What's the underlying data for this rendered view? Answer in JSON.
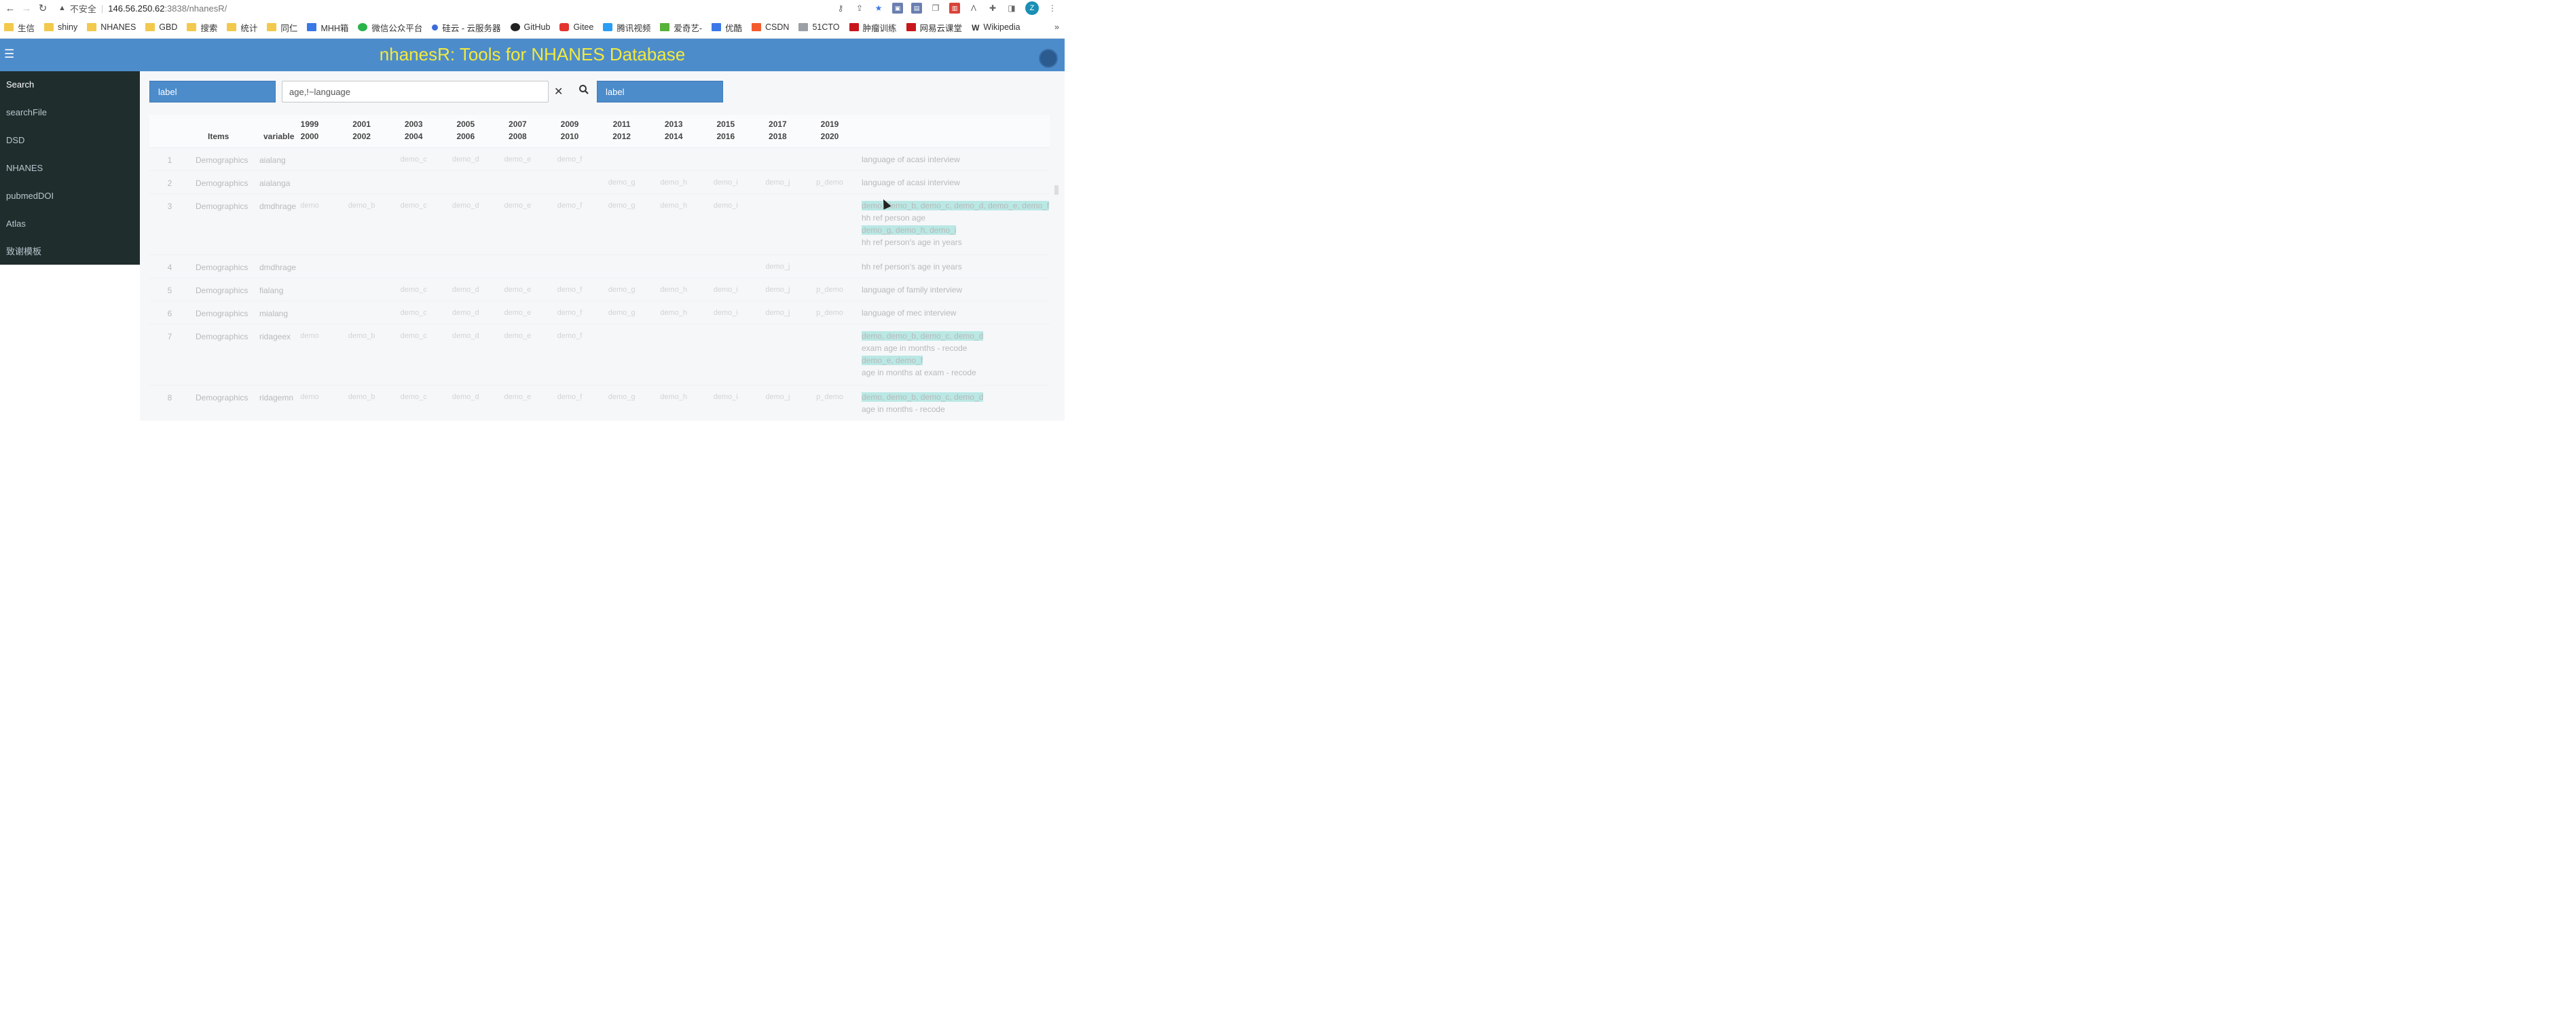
{
  "browser": {
    "insecure_label": "不安全",
    "url_host": "146.56.250.62",
    "url_path": ":3838/nhanesR/",
    "avatar_letter": "Z",
    "bookmarks": [
      {
        "label": "生信",
        "icon": "folder-icon"
      },
      {
        "label": "shiny",
        "icon": "folder-icon"
      },
      {
        "label": "NHANES",
        "icon": "folder-icon"
      },
      {
        "label": "GBD",
        "icon": "folder-icon"
      },
      {
        "label": "搜索",
        "icon": "folder-icon"
      },
      {
        "label": "统计",
        "icon": "folder-icon"
      },
      {
        "label": "同仁",
        "icon": "folder-icon"
      },
      {
        "label": "MHH箱",
        "icon": "outlook-icon"
      },
      {
        "label": "微信公众平台",
        "icon": "wechat-icon"
      },
      {
        "label": "硅云 - 云服务器",
        "icon": "cloud-icon"
      },
      {
        "label": "GitHub",
        "icon": "github-icon"
      },
      {
        "label": "Gitee",
        "icon": "gitee-icon"
      },
      {
        "label": "腾讯视频",
        "icon": "play-icon"
      },
      {
        "label": "爱奇艺-",
        "icon": "iqiyi-icon"
      },
      {
        "label": "优酷",
        "icon": "youku-icon"
      },
      {
        "label": "CSDN",
        "icon": "csdn-icon"
      },
      {
        "label": "51CTO",
        "icon": "51cto-icon"
      },
      {
        "label": "肿瘤训练",
        "icon": "pin-icon"
      },
      {
        "label": "网易云课堂",
        "icon": "netease-icon"
      },
      {
        "label": "Wikipedia",
        "icon": "wikipedia-icon"
      }
    ]
  },
  "app": {
    "title": "nhanesR: Tools for NHANES Database",
    "colors": {
      "header": "#4d8ccb",
      "title": "#f3ea3c",
      "sidebar": "#1f2d2d"
    }
  },
  "sidebar": {
    "items": [
      {
        "label": "Search"
      },
      {
        "label": "searchFile"
      },
      {
        "label": "DSD"
      },
      {
        "label": "NHANES"
      },
      {
        "label": "pubmedDOI"
      },
      {
        "label": "Atlas"
      },
      {
        "label": "致谢模板"
      }
    ]
  },
  "search": {
    "left_select": "label",
    "query": "age,!~language",
    "right_select": "label"
  },
  "table": {
    "headers": {
      "items": "Items",
      "variable": "variable"
    },
    "years": [
      [
        "1999",
        "2000"
      ],
      [
        "2001",
        "2002"
      ],
      [
        "2003",
        "2004"
      ],
      [
        "2005",
        "2006"
      ],
      [
        "2007",
        "2008"
      ],
      [
        "2009",
        "2010"
      ],
      [
        "2011",
        "2012"
      ],
      [
        "2013",
        "2014"
      ],
      [
        "2015",
        "2016"
      ],
      [
        "2017",
        "2018"
      ],
      [
        "2019",
        "2020"
      ]
    ],
    "rows": [
      {
        "n": "1",
        "items": "Demographics",
        "var": "aialang",
        "cells": [
          "",
          "",
          "demo_c",
          "demo_d",
          "demo_e",
          "demo_f",
          "",
          "",
          "",
          "",
          ""
        ],
        "labels": [
          "language of acasi interview"
        ]
      },
      {
        "n": "2",
        "items": "Demographics",
        "var": "aialanga",
        "cells": [
          "",
          "",
          "",
          "",
          "",
          "",
          "demo_g",
          "demo_h",
          "demo_i",
          "demo_j",
          "p_demo"
        ],
        "labels": [
          "language of acasi interview"
        ]
      },
      {
        "n": "3",
        "items": "Demographics",
        "var": "dmdhrage",
        "cells": [
          "demo",
          "demo_b",
          "demo_c",
          "demo_d",
          "demo_e",
          "demo_f",
          "demo_g",
          "demo_h",
          "demo_i",
          "",
          ""
        ],
        "labels": [
          "demo, demo_b, demo_c, demo_d, demo_e, demo_f",
          "hh ref person age",
          "demo_g, demo_h, demo_i",
          "hh ref person's age in years"
        ]
      },
      {
        "n": "4",
        "items": "Demographics",
        "var": "dmdhrage",
        "cells": [
          "",
          "",
          "",
          "",
          "",
          "",
          "",
          "",
          "",
          "demo_j",
          ""
        ],
        "labels": [
          "hh ref person's age in years"
        ]
      },
      {
        "n": "5",
        "items": "Demographics",
        "var": "fialang",
        "cells": [
          "",
          "",
          "demo_c",
          "demo_d",
          "demo_e",
          "demo_f",
          "demo_g",
          "demo_h",
          "demo_i",
          "demo_j",
          "p_demo"
        ],
        "labels": [
          "language of family interview"
        ]
      },
      {
        "n": "6",
        "items": "Demographics",
        "var": "mialang",
        "cells": [
          "",
          "",
          "demo_c",
          "demo_d",
          "demo_e",
          "demo_f",
          "demo_g",
          "demo_h",
          "demo_i",
          "demo_j",
          "p_demo"
        ],
        "labels": [
          "language of mec interview"
        ]
      },
      {
        "n": "7",
        "items": "Demographics",
        "var": "ridageex",
        "cells": [
          "demo",
          "demo_b",
          "demo_c",
          "demo_d",
          "demo_e",
          "demo_f",
          "",
          "",
          "",
          "",
          ""
        ],
        "labels": [
          "demo, demo_b, demo_c, demo_d",
          "exam age in months - recode",
          "demo_e, demo_f",
          "age in months at exam - recode"
        ]
      },
      {
        "n": "8",
        "items": "Demographics",
        "var": "ridagemn",
        "cells": [
          "demo",
          "demo_b",
          "demo_c",
          "demo_d",
          "demo_e",
          "demo_f",
          "demo_g",
          "demo_h",
          "demo_i",
          "demo_j",
          "p_demo"
        ],
        "labels": [
          "demo, demo_b, demo_c, demo_d",
          "age in months - recode"
        ]
      }
    ]
  }
}
